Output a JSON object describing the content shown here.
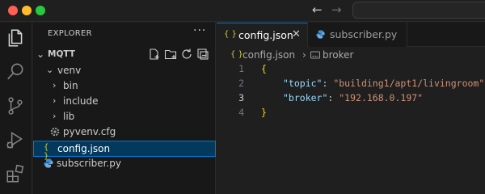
{
  "titlebar": {
    "back_glyph": "←",
    "forward_glyph": "→"
  },
  "activity_bar": {
    "icons": [
      "explorer-icon",
      "search-icon",
      "source-control-icon",
      "run-debug-icon",
      "extensions-icon"
    ]
  },
  "explorer": {
    "title": "EXPLORER",
    "more_glyph": "···",
    "section": {
      "label": "MQTT",
      "chevron": "⌄"
    },
    "tree": [
      {
        "label": "venv",
        "chevron": "⌄",
        "depth": 1
      },
      {
        "label": "bin",
        "chevron": "›",
        "depth": 2
      },
      {
        "label": "include",
        "chevron": "›",
        "depth": 2
      },
      {
        "label": "lib",
        "chevron": "›",
        "depth": 2
      },
      {
        "label": "pyvenv.cfg",
        "icon": "gear-icon",
        "depth": 2
      },
      {
        "label": "config.json",
        "icon_glyph": "{ }",
        "depth": 1,
        "selected": true
      },
      {
        "label": "subscriber.py",
        "icon": "python-icon",
        "depth": 1
      }
    ]
  },
  "tabs": [
    {
      "label": "config.json",
      "icon_glyph": "{ }",
      "active": true,
      "close_glyph": "✕"
    },
    {
      "label": "subscriber.py",
      "icon": "python-icon",
      "active": false
    }
  ],
  "breadcrumb": {
    "file_icon_glyph": "{ }",
    "file": "config.json",
    "separator": "›",
    "symbol": "broker"
  },
  "editor": {
    "lines": [
      {
        "number": "1",
        "open_brace": "{"
      },
      {
        "number": "2",
        "key": "\"topic\"",
        "value": "\"building1/apt1/livingroom\"",
        "trail": ","
      },
      {
        "number": "3",
        "key": "\"broker\"",
        "value": "\"192.168.0.197\"",
        "trail": ""
      },
      {
        "number": "4",
        "close_brace": "}"
      }
    ],
    "current_line": "3"
  },
  "colors": {
    "accent": "#0078d4",
    "selection_bg": "#04395e",
    "json_key": "#9cdcfe",
    "json_string": "#ce9178",
    "json_brace": "#ffd700",
    "json_icon": "#cbcb41",
    "python_icon": "#3f8fd0"
  }
}
